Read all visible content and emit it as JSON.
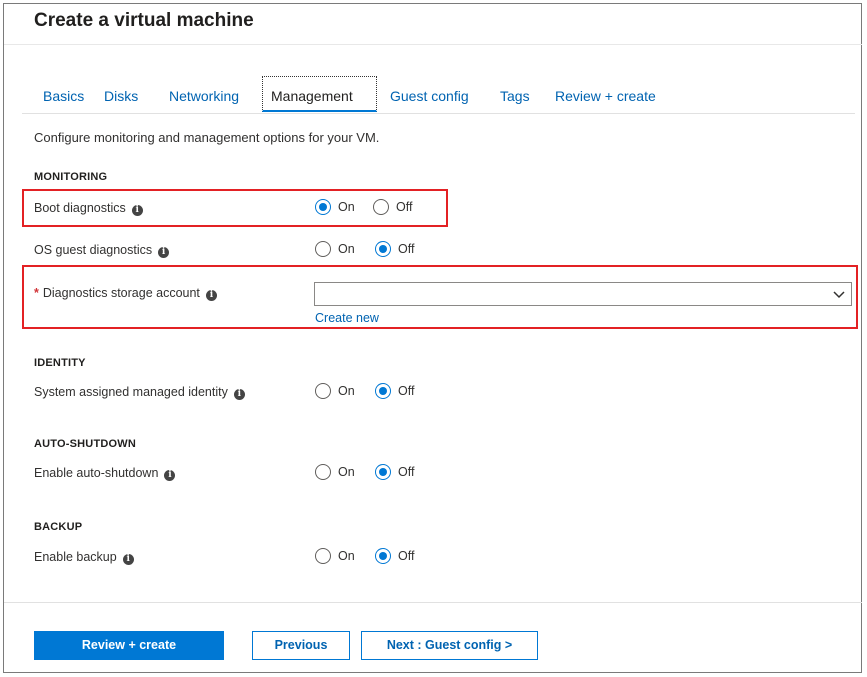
{
  "header": {
    "title": "Create a virtual machine"
  },
  "tabs": [
    {
      "label": "Basics"
    },
    {
      "label": "Disks"
    },
    {
      "label": "Networking"
    },
    {
      "label": "Management"
    },
    {
      "label": "Guest config"
    },
    {
      "label": "Tags"
    },
    {
      "label": "Review + create"
    }
  ],
  "active_tab": "Management",
  "description": "Configure monitoring and management options for your VM.",
  "sections": {
    "monitoring": "MONITORING",
    "identity": "IDENTITY",
    "auto_shutdown": "AUTO-SHUTDOWN",
    "backup": "BACKUP"
  },
  "fields": {
    "boot_diagnostics": {
      "label": "Boot diagnostics",
      "value": "On"
    },
    "os_guest_diagnostics": {
      "label": "OS guest diagnostics",
      "value": "Off"
    },
    "diagnostics_storage": {
      "required_mark": "*",
      "label": "Diagnostics storage account",
      "value": "",
      "link": "Create new"
    },
    "system_identity": {
      "label": "System assigned managed identity",
      "value": "Off"
    },
    "auto_shutdown": {
      "label": "Enable auto-shutdown",
      "value": "Off"
    },
    "backup": {
      "label": "Enable backup",
      "value": "Off"
    }
  },
  "radio_options": {
    "on": "On",
    "off": "Off"
  },
  "info_glyph": "i",
  "footer": {
    "review_create": "Review + create",
    "previous": "Previous",
    "next": "Next : Guest config >"
  },
  "colors": {
    "accent": "#0078d4",
    "link": "#0063b1",
    "highlight": "#e32124",
    "required": "#d13438"
  }
}
